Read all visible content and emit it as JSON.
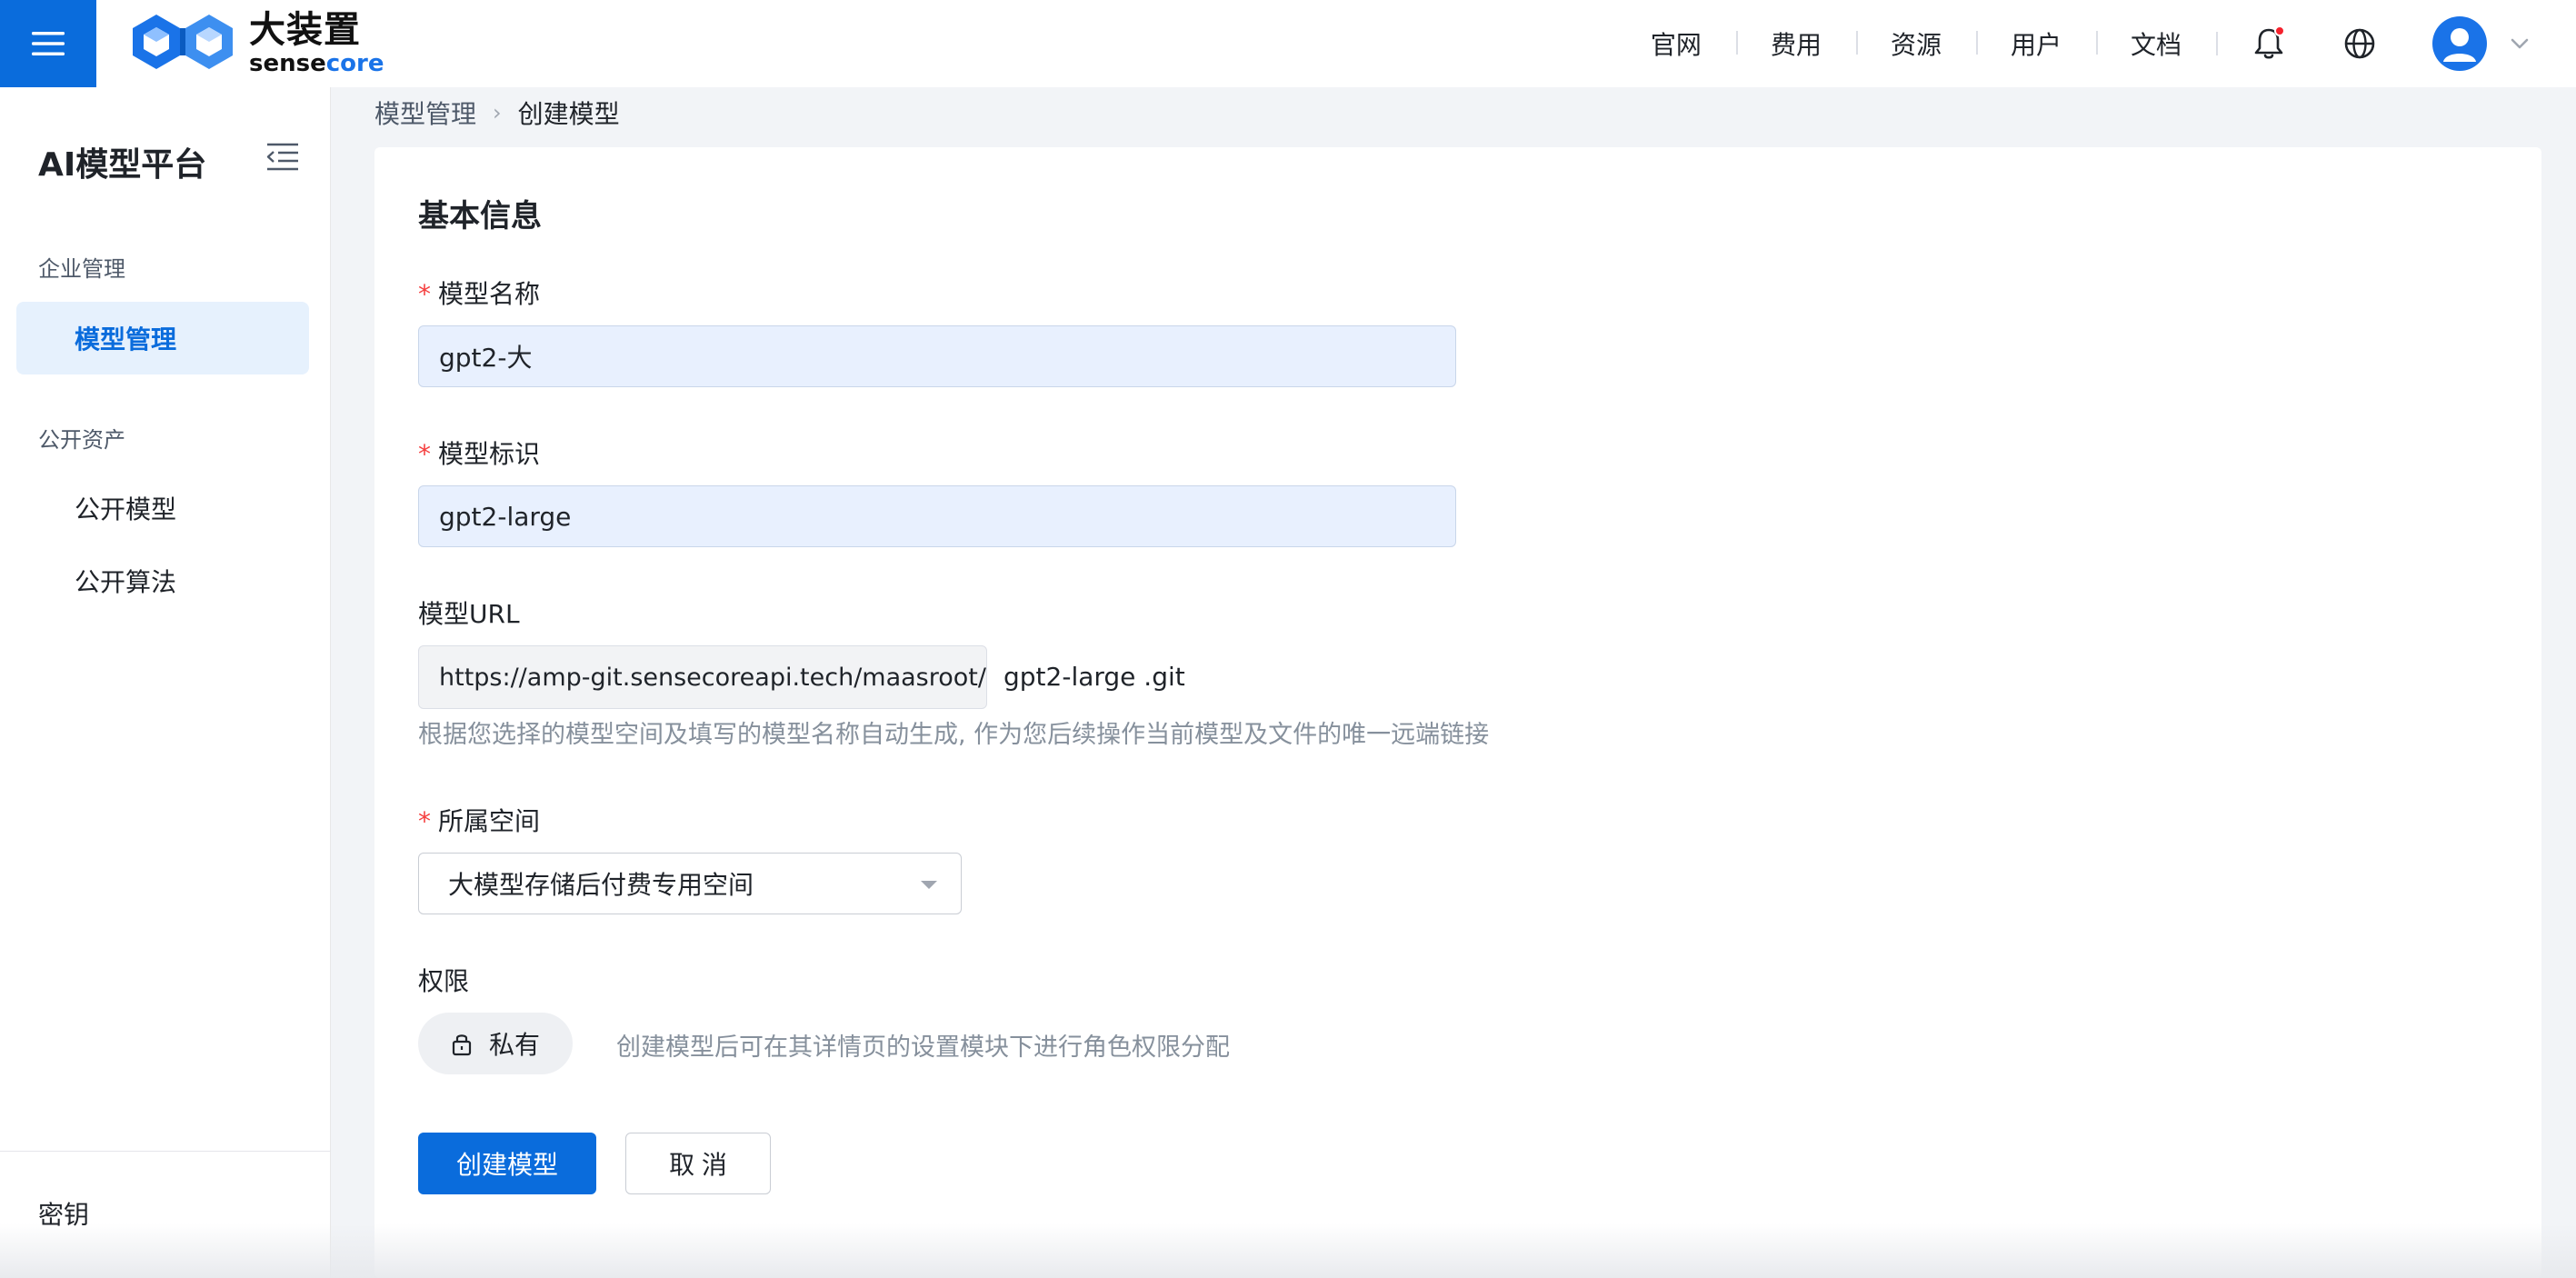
{
  "header": {
    "logo_cn": "大装置",
    "logo_en_prefix": "sense",
    "logo_en_suffix": "core",
    "nav": [
      "官网",
      "费用",
      "资源",
      "用户",
      "文档"
    ],
    "icons": [
      "menu-icon",
      "bell-icon",
      "globe-icon",
      "avatar-icon",
      "chevron-down-icon"
    ]
  },
  "sidebar": {
    "title": "AI模型平台",
    "groups": [
      {
        "label": "企业管理",
        "items": [
          {
            "label": "模型管理",
            "active": true
          }
        ]
      },
      {
        "label": "公开资产",
        "items": [
          {
            "label": "公开模型",
            "active": false
          },
          {
            "label": "公开算法",
            "active": false
          }
        ]
      }
    ],
    "bottom_item": "密钥"
  },
  "breadcrumb": {
    "parent": "模型管理",
    "current": "创建模型"
  },
  "form": {
    "section_title": "基本信息",
    "model_name": {
      "label": "模型名称",
      "value": "gpt2-大"
    },
    "model_id": {
      "label": "模型标识",
      "value": "gpt2-large"
    },
    "model_url": {
      "label": "模型URL",
      "prefix": "https://amp-git.sensecoreapi.tech/maasroot/",
      "suffix": "gpt2-large .git",
      "hint": "根据您选择的模型空间及填写的模型名称自动生成, 作为您后续操作当前模型及文件的唯一远端链接"
    },
    "space": {
      "label": "所属空间",
      "value": "大模型存储后付费专用空间"
    },
    "permission": {
      "label": "权限",
      "value": "私有",
      "hint": "创建模型后可在其详情页的设置模块下进行角色权限分配"
    },
    "submit_label": "创建模型",
    "cancel_label": "取 消"
  },
  "colors": {
    "brand": "#0a6cdc",
    "required": "#f53f3f",
    "active_bg": "#e6f1fd",
    "bell_dot": "#f5222d"
  }
}
